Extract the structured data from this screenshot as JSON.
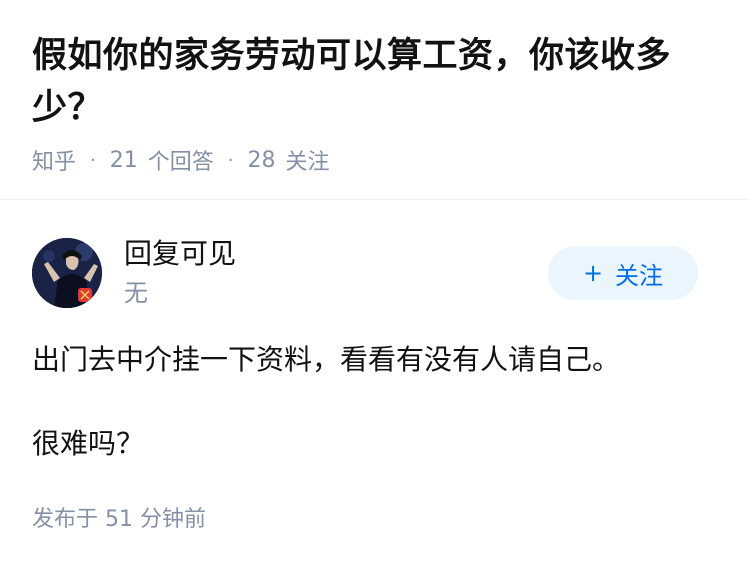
{
  "question": {
    "title": "假如你的家务劳动可以算工资，你该收多少？",
    "site": "知乎",
    "answer_count": "21",
    "answer_label": "个回答",
    "follower_count": "28",
    "follower_label": "关注"
  },
  "answer": {
    "author": {
      "name": "回复可见",
      "headline": "无",
      "avatar_icon": "avatar-icon"
    },
    "follow_button": {
      "icon": "plus-icon",
      "label": "关注",
      "color": "#056de8",
      "background": "#ebf5fd"
    },
    "content": [
      "出门去中介挂一下资料，看看有没有人请自己。",
      "很难吗？"
    ],
    "published_label": "发布于",
    "published_time": "51 分钟前"
  },
  "colors": {
    "text_primary": "#121212",
    "text_secondary": "#8590a6",
    "divider": "#f0f2f5"
  }
}
